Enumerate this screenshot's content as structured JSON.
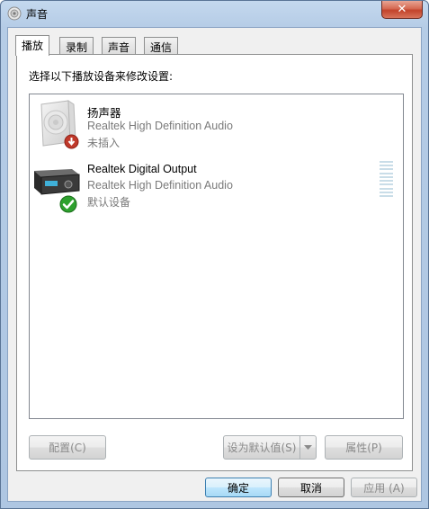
{
  "window": {
    "title": "声音",
    "close_label": "✕"
  },
  "tabs": [
    {
      "label": "播放",
      "active": true
    },
    {
      "label": "录制",
      "active": false
    },
    {
      "label": "声音",
      "active": false
    },
    {
      "label": "通信",
      "active": false
    }
  ],
  "playback": {
    "instruction": "选择以下播放设备来修改设置:",
    "devices": [
      {
        "name": "扬声器",
        "driver": "Realtek High Definition Audio",
        "status": "未插入",
        "icon": "speaker-icon",
        "badge": "unplugged-icon"
      },
      {
        "name": "Realtek Digital Output",
        "driver": "Realtek High Definition Audio",
        "status": "默认设备",
        "icon": "digital-output-icon",
        "badge": "default-check-icon",
        "level": 0
      }
    ],
    "configure_label": "配置(C)",
    "set_default_label": "设为默认值(S)",
    "properties_label": "属性(P)"
  },
  "footer": {
    "ok_label": "确定",
    "cancel_label": "取消",
    "apply_label": "应用 (A)"
  },
  "colors": {
    "title_bar": "#b5cce6",
    "close_button": "#c2432b",
    "default_button_border": "#3c7fb1",
    "disabled_text": "#8a8a8a",
    "driver_text": "#7a7a7a",
    "check_green": "#2ea12e",
    "unplugged_red": "#c0392b"
  }
}
